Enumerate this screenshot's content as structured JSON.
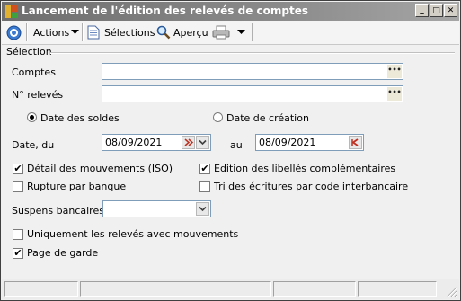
{
  "window": {
    "title": "Lancement de l'édition des relevés de comptes",
    "minimize": "_",
    "maximize": "□",
    "close": "✕"
  },
  "toolbar": {
    "actions_label": "Actions",
    "selections_label": "Sélections",
    "apercu_label": "Aperçu"
  },
  "form": {
    "group_label": "Sélection",
    "comptes_label": "Comptes",
    "comptes_value": "",
    "releves_label": "N° relevés",
    "releves_value": "",
    "dots": "•••",
    "radio_soldes": "Date des soldes",
    "radio_creation": "Date de création",
    "date_du_label": "Date, du",
    "date_du_value": "08/09/2021",
    "date_au_label": "au",
    "date_au_value": "08/09/2021",
    "detail_mouvements": "Détail des mouvements (ISO)",
    "edition_libelles": "Edition des libellés complémentaires",
    "rupture_banque": "Rupture par banque",
    "tri_ecritures": "Tri des écritures par code interbancaire",
    "suspens_label": "Suspens bancaires",
    "suspens_value": "",
    "uniquement_releves": "Uniquement les relevés avec mouvements",
    "page_garde": "Page de garde",
    "checked_mark": "✔"
  }
}
